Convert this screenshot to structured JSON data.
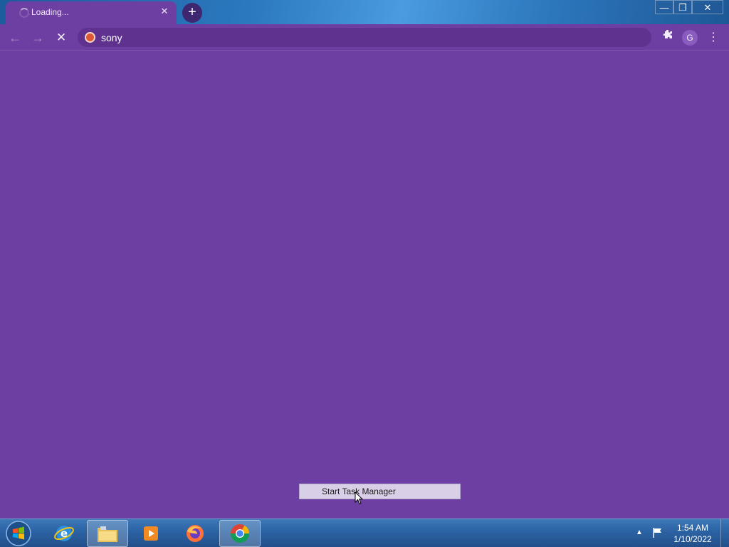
{
  "browser": {
    "tab": {
      "title": "Loading...",
      "close_glyph": "✕"
    },
    "new_tab_glyph": "+",
    "window_controls": {
      "minimize": "—",
      "restore": "❐",
      "close": "✕"
    },
    "nav": {
      "back": "←",
      "forward": "→",
      "stop": "✕"
    },
    "omnibox": {
      "value": "sony",
      "search_engine_icon": "duckduckgo-icon"
    },
    "toolbar": {
      "extensions_icon": "puzzle-icon",
      "profile_initial": "G",
      "menu_glyph": "⋮"
    },
    "accent_color": "#6e3fa2"
  },
  "context_menu": {
    "items": [
      {
        "label": "Start Task Manager"
      }
    ]
  },
  "taskbar": {
    "pinned": [
      {
        "name": "internet-explorer",
        "icon": "ie-icon"
      },
      {
        "name": "windows-explorer",
        "icon": "folder-icon"
      },
      {
        "name": "media-player",
        "icon": "media-icon"
      },
      {
        "name": "firefox",
        "icon": "firefox-icon"
      },
      {
        "name": "chrome",
        "icon": "chrome-icon",
        "active": true
      }
    ],
    "clock": {
      "time": "1:54 AM",
      "date": "1/10/2022"
    }
  }
}
